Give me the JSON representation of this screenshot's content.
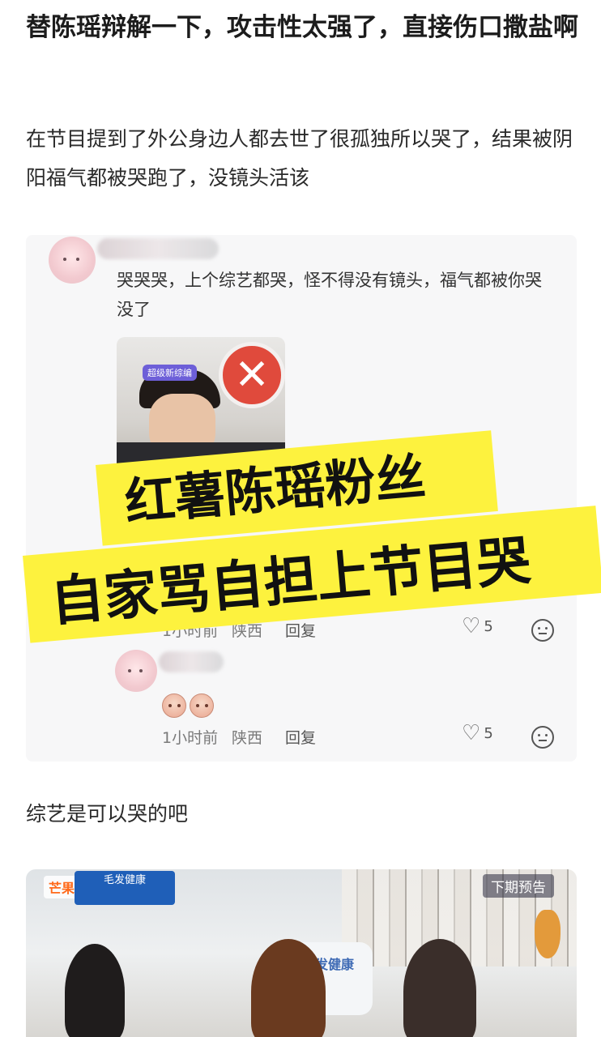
{
  "post": {
    "title": "替陈瑶辩解一下，攻击性太强了，直接伤口撒盐啊",
    "paragraph1": "在节目提到了外公身边人都去世了很孤独所以哭了，结果被阴阳福气都被哭跑了，没镜头活该",
    "paragraph2": "综艺是可以哭的吧"
  },
  "comment1": {
    "text": "哭哭哭，上个综艺都哭，怪不得没有镜头，福气都被你哭没了",
    "image_tag": "超级新综编",
    "time": "1小时前",
    "location": "陕西",
    "reply_label": "回复",
    "likes": "5"
  },
  "comment2": {
    "time": "1小时前",
    "location": "陕西",
    "reply_label": "回复",
    "likes": "5"
  },
  "banner": {
    "line1": "红薯陈瑶粉丝",
    "line2": "自家骂自担上节目哭"
  },
  "video": {
    "logo": "芒果tv",
    "sponsor": "毛发健康",
    "preview_badge": "下期预告",
    "pillow_text": "毛发健康"
  },
  "colors": {
    "banner": "#fdf23e",
    "card_bg": "#f7f7f8",
    "x_sign": "#e04a3c"
  }
}
